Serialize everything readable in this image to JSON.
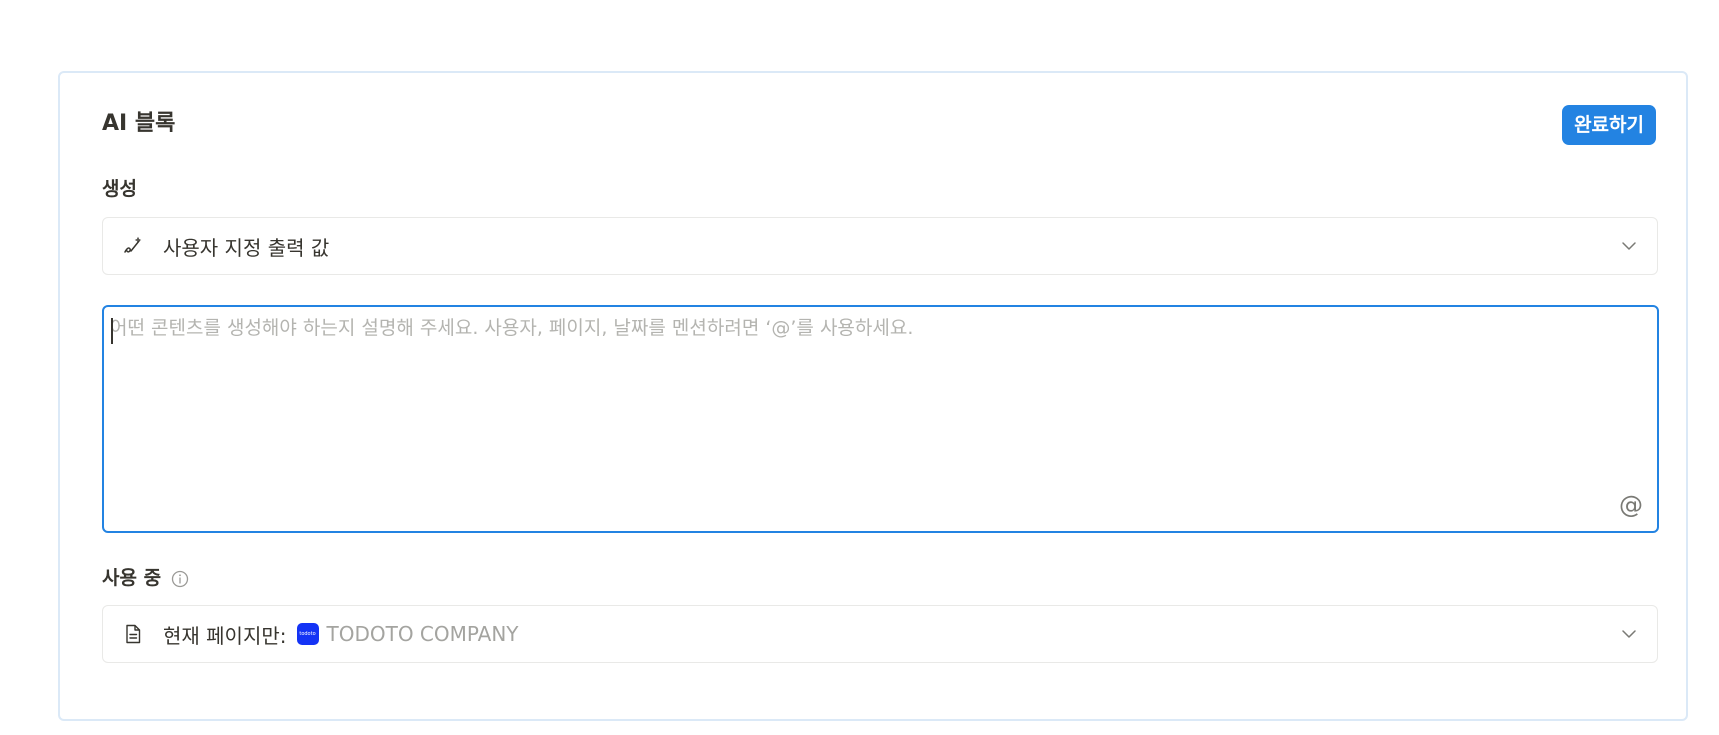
{
  "block": {
    "title": "AI 블록",
    "done_label": "완료하기"
  },
  "generate": {
    "label": "생성",
    "selected_option": "사용자 지정 출력 값",
    "option_icon": "pen-sparkle-icon"
  },
  "prompt": {
    "value": "",
    "placeholder": "어떤 콘텐츠를 생성해야 하는지 설명해 주세요. 사용자, 페이지, 날짜를 멘션하려면 ‘@’를 사용하세요.",
    "mention_symbol": "@"
  },
  "usage": {
    "label": "사용 중",
    "info_icon": "info-icon",
    "scope_text": "현재 페이지만:",
    "page_logo_text": "todoto",
    "page_name": "TODOTO COMPANY",
    "scope_icon": "document-icon"
  },
  "colors": {
    "accent": "#2383e2",
    "border": "#dbe9f7",
    "muted_text": "#a4a4a0",
    "logo_bg": "#1433f5"
  }
}
